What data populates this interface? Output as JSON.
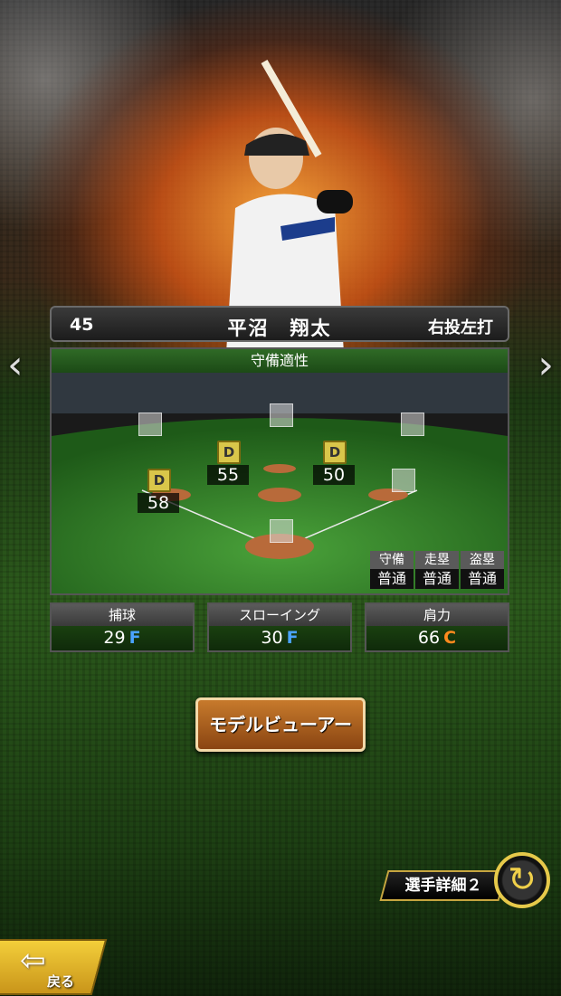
{
  "player": {
    "number": "45",
    "name": "平沼　翔太",
    "throw_bat": "右投左打"
  },
  "defense": {
    "title": "守備適性",
    "positions": [
      {
        "pos": "third",
        "grade": "D",
        "value": "58"
      },
      {
        "pos": "shortstop",
        "grade": "D",
        "value": "55"
      },
      {
        "pos": "second",
        "grade": "D",
        "value": "50"
      }
    ],
    "mini_stats": {
      "headers": [
        "守備",
        "走塁",
        "盗塁"
      ],
      "values": [
        "普通",
        "普通",
        "普通"
      ]
    }
  },
  "ratings": [
    {
      "label": "捕球",
      "value": "29",
      "grade": "F",
      "grade_color": "#4aa3ff"
    },
    {
      "label": "スローイング",
      "value": "30",
      "grade": "F",
      "grade_color": "#4aa3ff"
    },
    {
      "label": "肩力",
      "value": "66",
      "grade": "C",
      "grade_color": "#ff8a1e"
    }
  ],
  "buttons": {
    "model_viewer": "モデルビューアー",
    "player_detail": "選手詳細２",
    "back": "戻る"
  },
  "icons": {
    "prev": "chevron-left-icon",
    "next": "chevron-right-icon",
    "cycle": "cycle-arrows-icon",
    "back": "back-arrow-icon"
  }
}
